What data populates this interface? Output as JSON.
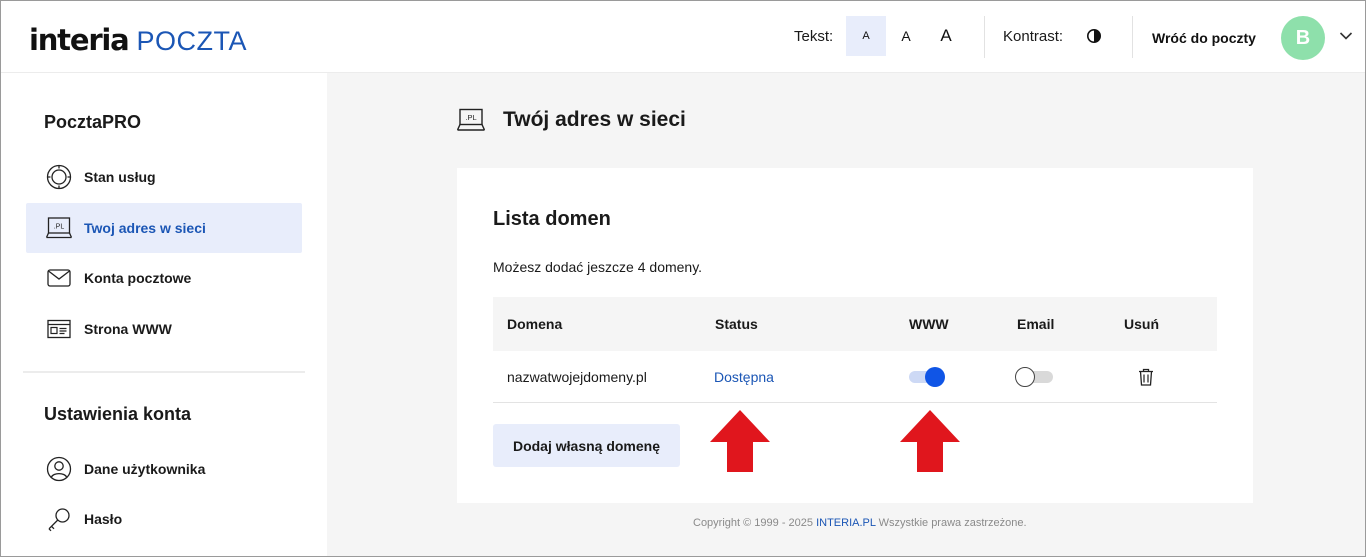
{
  "header": {
    "logo_brand": "interia",
    "logo_product": "POCZTA",
    "text_label": "Tekst:",
    "font_sizes": [
      "A",
      "A",
      "A"
    ],
    "contrast_label": "Kontrast:",
    "back_label": "Wróć do poczty",
    "avatar_initial": "B"
  },
  "sidebar": {
    "section1_title": "PocztaPRO",
    "items": [
      {
        "label": "Stan usług",
        "icon": "service-status-icon"
      },
      {
        "label": "Twoj adres w sieci",
        "icon": "domain-pl-icon",
        "active": true
      },
      {
        "label": "Konta pocztowe",
        "icon": "envelope-icon"
      },
      {
        "label": "Strona WWW",
        "icon": "webpage-icon"
      }
    ],
    "section2_title": "Ustawienia konta",
    "items2": [
      {
        "label": "Dane użytkownika",
        "icon": "user-icon"
      },
      {
        "label": "Hasło",
        "icon": "key-icon"
      }
    ]
  },
  "main": {
    "title": "Twój adres w sieci",
    "card_title": "Lista domen",
    "card_subtitle": "Możesz dodać jeszcze 4 domeny.",
    "table": {
      "columns": [
        "Domena",
        "Status",
        "WWW",
        "Email",
        "Usuń"
      ],
      "rows": [
        {
          "domain": "nazwatwojejdomeny.pl",
          "status": "Dostępna",
          "www": true,
          "email": false
        }
      ]
    },
    "add_button": "Dodaj własną domenę",
    "footer": {
      "prefix": "Copyright © 1999 - 2025 ",
      "brand": "INTERIA.PL",
      "suffix": " Wszystkie prawa zastrzeżone."
    }
  },
  "colors": {
    "accent": "#1b56b5",
    "toggle_on": "#1055e6",
    "active_bg": "#e8edfb",
    "avatar": "#8ee0ab",
    "annotation_arrow": "#e0161d"
  }
}
